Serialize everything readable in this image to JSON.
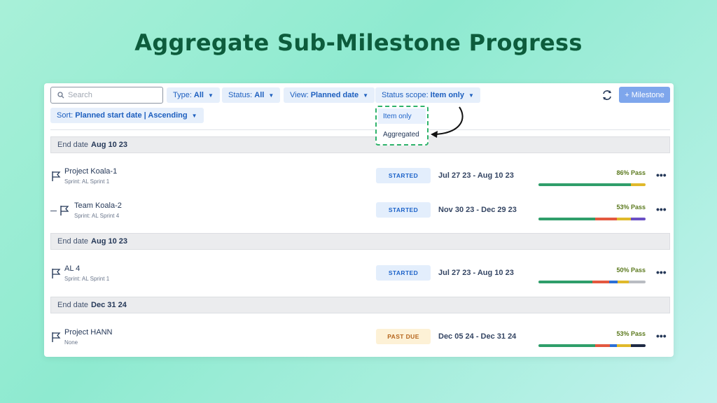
{
  "headline": "Aggregate Sub-Milestone Progress",
  "toolbar": {
    "search_placeholder": "Search",
    "filters": [
      {
        "label": "Type:",
        "value": "All"
      },
      {
        "label": "Status:",
        "value": "All"
      },
      {
        "label": "View:",
        "value": "Planned date"
      },
      {
        "label": "Status scope:",
        "value": "Item only"
      }
    ],
    "sort": {
      "label": "Sort:",
      "value": "Planned start date | Ascending"
    },
    "add_button": "+ Milestone",
    "refresh_icon": "refresh-icon"
  },
  "status_scope_dropdown": {
    "options": [
      "Item only",
      "Aggregated"
    ],
    "selected": "Item only"
  },
  "groups": [
    {
      "label": "End date",
      "date": "Aug 10 23"
    },
    {
      "label": "End date",
      "date": "Aug 10 23"
    },
    {
      "label": "End date",
      "date": "Dec 31 24"
    }
  ],
  "rows": [
    {
      "name": "Project Koala-1",
      "sub": "Sprint: AL Sprint 1",
      "status": "STARTED",
      "dates": "Jul 27 23 - Aug 10 23",
      "pass": "86% Pass",
      "progress": [
        {
          "color": "#2f9e6a",
          "value": 86
        },
        {
          "color": "#e0b92b",
          "value": 14
        }
      ]
    },
    {
      "name": "Team Koala-2",
      "sub": "Sprint: AL Sprint 4",
      "status": "STARTED",
      "dates": "Nov 30 23 - Dec 29 23",
      "pass": "53% Pass",
      "progress": [
        {
          "color": "#2f9e6a",
          "value": 53
        },
        {
          "color": "#e3583f",
          "value": 20
        },
        {
          "color": "#e0b92b",
          "value": 13
        },
        {
          "color": "#6a4fc4",
          "value": 14
        }
      ]
    },
    {
      "name": "AL 4",
      "sub": "Sprint: AL Sprint 1",
      "status": "STARTED",
      "dates": "Jul 27 23 - Aug 10 23",
      "pass": "50% Pass",
      "progress": [
        {
          "color": "#2f9e6a",
          "value": 50
        },
        {
          "color": "#e3583f",
          "value": 16
        },
        {
          "color": "#2b6fd6",
          "value": 8
        },
        {
          "color": "#e0b92b",
          "value": 10
        },
        {
          "color": "#b9bcc2",
          "value": 16
        }
      ]
    },
    {
      "name": "Project HANN",
      "sub": "None",
      "status": "PAST DUE",
      "dates": "Dec 05 24 - Dec 31 24",
      "pass": "53% Pass",
      "progress": [
        {
          "color": "#2f9e6a",
          "value": 53
        },
        {
          "color": "#e3583f",
          "value": 14
        },
        {
          "color": "#2b6fd6",
          "value": 6
        },
        {
          "color": "#e0b92b",
          "value": 13
        },
        {
          "color": "#1f2a44",
          "value": 14
        }
      ]
    }
  ]
}
